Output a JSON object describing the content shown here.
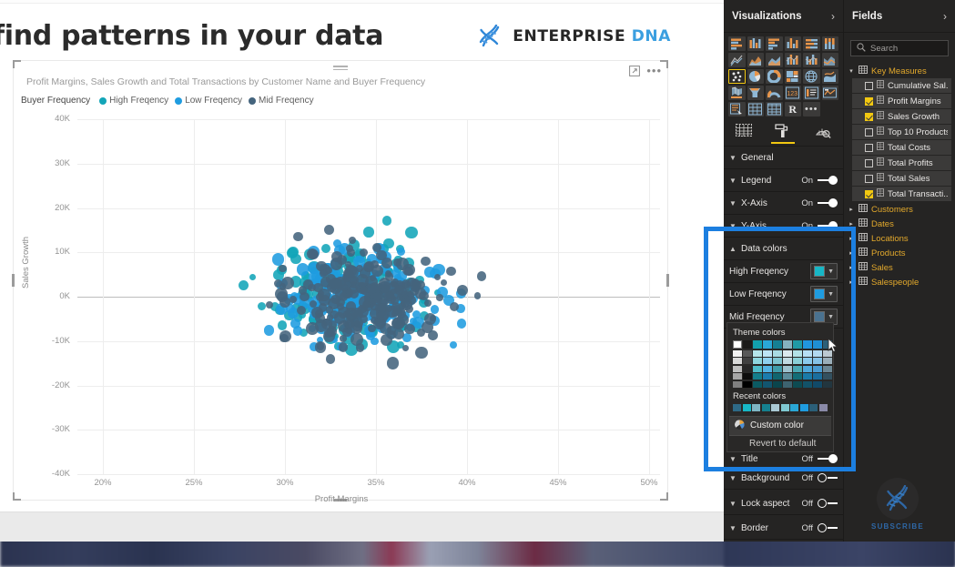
{
  "page": {
    "heading": "find patterns in your data"
  },
  "brand": {
    "name_primary": "ENTERPRISE",
    "name_secondary": "DNA",
    "logo_icon": "dna-helix-icon"
  },
  "visual": {
    "title": "Profit Margins, Sales Growth and Total Transactions by Customer Name and Buyer Frequency",
    "focus_icon": "focus-mode-icon",
    "more_icon": "more-options-icon",
    "drag_handle": "drag-handle-icon"
  },
  "chart_data": {
    "type": "scatter",
    "title": "Profit Margins, Sales Growth and Total Transactions by Customer Name and Buyer Frequency",
    "xlabel": "Profit Margins",
    "ylabel": "Sales Growth",
    "xticks": [
      "20%",
      "25%",
      "30%",
      "35%",
      "40%",
      "45%",
      "50%"
    ],
    "yticks": [
      "40K",
      "30K",
      "20K",
      "10K",
      "0K",
      "-10K",
      "-20K",
      "-30K",
      "-40K"
    ],
    "xlim": [
      17.5,
      51.5
    ],
    "ylim": [
      -40000,
      40000
    ],
    "grid": true,
    "legend_position": "top-left",
    "legend_title": "Buyer Frequency",
    "series": [
      {
        "name": "High Freqency",
        "color": "#12a5b8",
        "count": 168
      },
      {
        "name": "Low Freqency",
        "color": "#1f9ce0",
        "count": 196
      },
      {
        "name": "Mid Freqency",
        "color": "#44647d",
        "count": 246
      }
    ]
  },
  "visualizations_pane": {
    "title": "Visualizations",
    "collapse_icon": "chevron-right-icon",
    "icons": [
      "stacked-bar-chart",
      "stacked-column-chart",
      "clustered-bar-chart",
      "clustered-column-chart",
      "100-stacked-bar-chart",
      "100-stacked-column-chart",
      "line-chart",
      "area-chart",
      "stacked-area-chart",
      "line-stacked-column-chart",
      "line-clustered-column-chart",
      "ribbon-chart",
      "scatter-chart",
      "pie-chart",
      "donut-chart",
      "treemap",
      "map",
      "filled-map",
      "shape-map",
      "funnel-chart",
      "gauge-chart",
      "card",
      "multi-row-card",
      "kpi",
      "slicer",
      "table",
      "matrix",
      "r-script-visual",
      "more-visuals"
    ],
    "selected_icon": "scatter-chart",
    "tabs": [
      {
        "name": "fields-tab",
        "icon": "fields-table-icon",
        "active": false
      },
      {
        "name": "format-tab",
        "icon": "paint-roller-icon",
        "active": true
      },
      {
        "name": "analytics-tab",
        "icon": "magnifier-analytics-icon",
        "active": false
      }
    ],
    "properties": [
      {
        "label": "General",
        "state": null,
        "expanded": false
      },
      {
        "label": "Legend",
        "state": "On",
        "toggle": "on"
      },
      {
        "label": "X-Axis",
        "state": "On",
        "toggle": "on"
      },
      {
        "label": "Y-Axis",
        "state": "On",
        "toggle": "on"
      },
      {
        "label": "Data colors",
        "state": null,
        "expanded": true
      }
    ],
    "data_colors": [
      {
        "label": "High Freqency",
        "color": "#17b7c6"
      },
      {
        "label": "Low Freqency",
        "color": "#1f9ce0"
      },
      {
        "label": "Mid Freqency",
        "color": "#4a7290"
      }
    ],
    "bottom_properties": [
      {
        "label": "Title",
        "state": "Off",
        "toggle": "on"
      },
      {
        "label": "Background",
        "state": "Off",
        "toggle": "off"
      },
      {
        "label": "Lock aspect",
        "state": "Off",
        "toggle": "off"
      },
      {
        "label": "Border",
        "state": "Off",
        "toggle": "off"
      }
    ]
  },
  "color_picker": {
    "theme_colors_label": "Theme colors",
    "recent_colors_label": "Recent colors",
    "custom_color_label": "Custom color",
    "custom_color_icon": "color-wheel-icon",
    "revert_label": "Revert to default",
    "theme_row_top": [
      "#ffffff",
      "#1b1a19",
      "#12a0ad",
      "#2aa7d6",
      "#157f93",
      "#86b2bf",
      "#1f9aa5",
      "#2196de",
      "#1f8fd4",
      "#2b5f78"
    ],
    "theme_columns": [
      [
        "#f2f2f2",
        "#d9d9d9",
        "#bfbfbf",
        "#a6a6a6",
        "#808080"
      ],
      [
        "#595959",
        "#404040",
        "#262626",
        "#0d0d0d",
        "#000000"
      ],
      [
        "#b5e5ea",
        "#8ed6de",
        "#4fbcc9",
        "#147f8c",
        "#0b5a63"
      ],
      [
        "#bde4f5",
        "#8fd0ee",
        "#53b3e3",
        "#1b7cae",
        "#12556f"
      ],
      [
        "#a9dbe3",
        "#7fc5d1",
        "#3f9caa",
        "#10656f",
        "#0a454d"
      ],
      [
        "#dbe9ee",
        "#c0d9e1",
        "#9dc2ce",
        "#5d8d9b",
        "#3d6370"
      ],
      [
        "#b3e2e7",
        "#8bd0d7",
        "#4ba8b3",
        "#136d77",
        "#0d4b52"
      ],
      [
        "#b7dff4",
        "#8bcaec",
        "#4fa8da",
        "#1a7aa8",
        "#125268"
      ],
      [
        "#b2d9f0",
        "#86c2e6",
        "#4a9bd1",
        "#1a6e9e",
        "#114a68"
      ],
      [
        "#bcc9d1",
        "#9aaeb9",
        "#6b8694",
        "#33505f",
        "#22363f"
      ]
    ],
    "recent_colors": [
      "#2e6a87",
      "#17b7c6",
      "#7fb6c4",
      "#15808f",
      "#a9c9d4",
      "#7fc8d1",
      "#2aa7d6",
      "#1f9ce0",
      "#2b5f78",
      "#8a8aa8"
    ]
  },
  "fields_pane": {
    "title": "Fields",
    "collapse_icon": "chevron-right-icon",
    "search_placeholder": "Search",
    "search_icon": "search-icon",
    "groups": [
      {
        "name": "Key Measures",
        "expanded": true,
        "items": [
          {
            "label": "Cumulative Sal...",
            "checked": false
          },
          {
            "label": "Profit Margins",
            "checked": true
          },
          {
            "label": "Sales Growth",
            "checked": true
          },
          {
            "label": "Top 10 Products",
            "checked": false
          },
          {
            "label": "Total Costs",
            "checked": false
          },
          {
            "label": "Total Profits",
            "checked": false
          },
          {
            "label": "Total Sales",
            "checked": false
          },
          {
            "label": "Total Transacti...",
            "checked": true
          }
        ]
      },
      {
        "name": "Customers",
        "expanded": false,
        "highlighted": true,
        "items": []
      },
      {
        "name": "Dates",
        "expanded": false,
        "items": []
      },
      {
        "name": "Locations",
        "expanded": false,
        "items": []
      },
      {
        "name": "Products",
        "expanded": false,
        "items": []
      },
      {
        "name": "Sales",
        "expanded": false,
        "items": []
      },
      {
        "name": "Salespeople",
        "expanded": false,
        "items": []
      }
    ]
  },
  "subscribe": {
    "label": "SUBSCRIBE",
    "icon": "dna-helix-icon"
  },
  "colors": {
    "accent_blue": "#1c7fe0",
    "highlight_yellow": "#f2c811",
    "pane_bg": "#252423",
    "series_high": "#12a5b8",
    "series_low": "#1f9ce0",
    "series_mid": "#44647d"
  }
}
